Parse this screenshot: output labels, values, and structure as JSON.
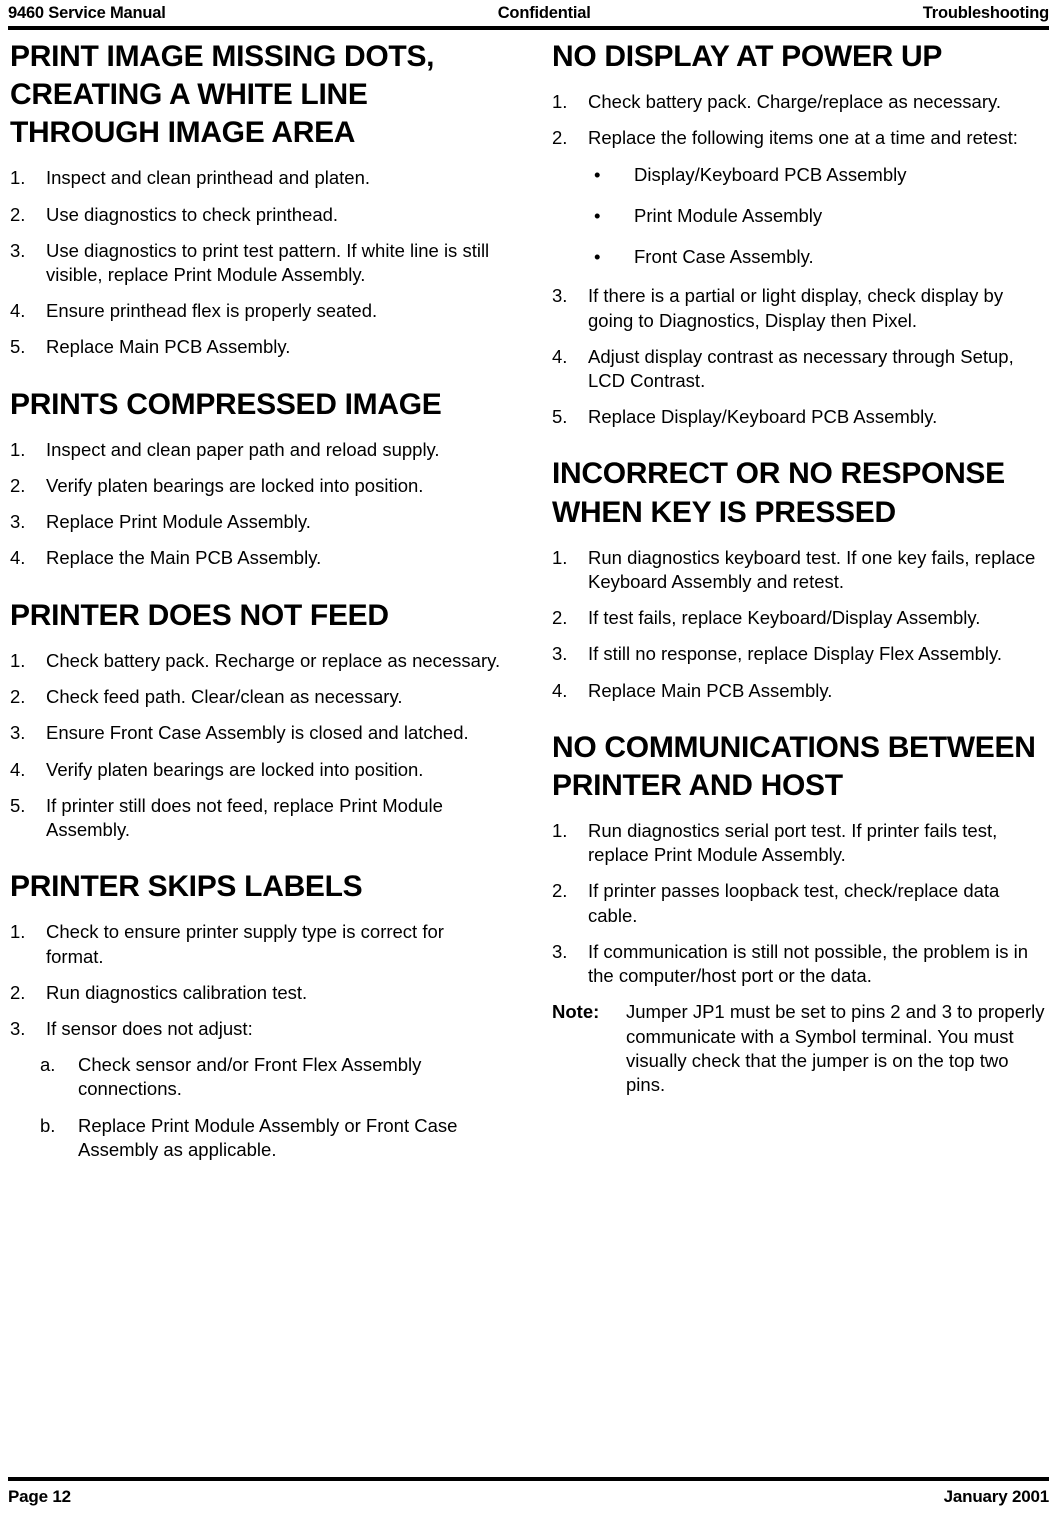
{
  "header": {
    "left": "9460 Service Manual",
    "center": "Confidential",
    "right": "Troubleshooting"
  },
  "footer": {
    "left": "Page 12",
    "right": "January 2001"
  },
  "left_column": {
    "sections": [
      {
        "title": "PRINT IMAGE MISSING DOTS, CREATING A WHITE LINE THROUGH IMAGE AREA",
        "steps": [
          {
            "marker": "1.",
            "text": "Inspect and clean printhead and platen."
          },
          {
            "marker": "2.",
            "text": "Use diagnostics to check printhead."
          },
          {
            "marker": "3.",
            "text": "Use diagnostics to print test pattern.  If white line is still visible, replace Print Module Assembly."
          },
          {
            "marker": "4.",
            "text": "Ensure printhead flex is properly seated."
          },
          {
            "marker": "5.",
            "text": "Replace Main PCB Assembly."
          }
        ]
      },
      {
        "title": "PRINTS COMPRESSED IMAGE",
        "steps": [
          {
            "marker": "1.",
            "text": "Inspect and clean paper path and reload supply."
          },
          {
            "marker": "2.",
            "text": "Verify platen bearings are locked into position."
          },
          {
            "marker": "3.",
            "text": "Replace Print Module Assembly."
          },
          {
            "marker": "4.",
            "text": "Replace the Main PCB Assembly."
          }
        ]
      },
      {
        "title": "PRINTER DOES NOT FEED",
        "steps": [
          {
            "marker": "1.",
            "text": "Check battery pack.  Recharge or replace as necessary."
          },
          {
            "marker": "2.",
            "text": "Check feed path.  Clear/clean as necessary."
          },
          {
            "marker": "3.",
            "text": "Ensure Front Case Assembly is closed and latched."
          },
          {
            "marker": "4.",
            "text": "Verify platen bearings are locked into position."
          },
          {
            "marker": "5.",
            "text": "If printer still does not feed, replace Print Module Assembly."
          }
        ]
      },
      {
        "title": "PRINTER SKIPS LABELS",
        "steps": [
          {
            "marker": "1.",
            "text": "Check to ensure printer supply type is correct for format."
          },
          {
            "marker": "2.",
            "text": "Run diagnostics calibration test."
          },
          {
            "marker": "3.",
            "text": "If sensor does not adjust:"
          }
        ],
        "substeps": [
          {
            "marker": "a.",
            "text": "Check sensor and/or Front Flex Assembly connections."
          },
          {
            "marker": "b.",
            "text": "Replace Print Module Assembly or Front Case Assembly as applicable."
          }
        ]
      }
    ]
  },
  "right_column": {
    "sections": [
      {
        "title": "NO DISPLAY AT POWER UP",
        "steps_a": [
          {
            "marker": "1.",
            "text": "Check battery pack.  Charge/replace as necessary."
          },
          {
            "marker": "2.",
            "text": "Replace the following items one at a time and retest:"
          }
        ],
        "bullets": [
          {
            "marker": "•",
            "text": "Display/Keyboard PCB Assembly"
          },
          {
            "marker": "•",
            "text": "Print Module Assembly"
          },
          {
            "marker": "•",
            "text": "Front Case Assembly."
          }
        ],
        "steps_b": [
          {
            "marker": "3.",
            "text": "If there is a partial or light display, check display by going to Diagnostics, Display then Pixel."
          },
          {
            "marker": "4.",
            "text": "Adjust display contrast as necessary through Setup, LCD Contrast."
          },
          {
            "marker": "5.",
            "text": "Replace Display/Keyboard PCB Assembly."
          }
        ]
      },
      {
        "title": "INCORRECT OR NO RESPONSE WHEN KEY IS PRESSED",
        "steps_a": [
          {
            "marker": "1.",
            "text": "Run diagnostics keyboard test.  If one key fails, replace Keyboard Assembly and retest."
          },
          {
            "marker": "2.",
            "text": "If test fails, replace Keyboard/Display Assembly."
          },
          {
            "marker": "3.",
            "text": "If still no response, replace Display Flex Assembly."
          },
          {
            "marker": "4.",
            "text": "Replace Main PCB Assembly."
          }
        ]
      },
      {
        "title": "NO COMMUNICATIONS BETWEEN PRINTER AND HOST",
        "steps_a": [
          {
            "marker": "1.",
            "text": "Run diagnostics serial port test.  If printer fails test, replace Print Module Assembly."
          },
          {
            "marker": "2.",
            "text": "If printer passes loopback test, check/replace data cable."
          },
          {
            "marker": "3.",
            "text": "If communication is still not possible, the problem is in the computer/host port or the data."
          }
        ],
        "note": {
          "marker": "Note:",
          "text": "Jumper JP1 must be set to pins 2 and 3 to properly communicate with a Symbol terminal.  You must visually check that the jumper is on the top two pins."
        }
      }
    ]
  }
}
